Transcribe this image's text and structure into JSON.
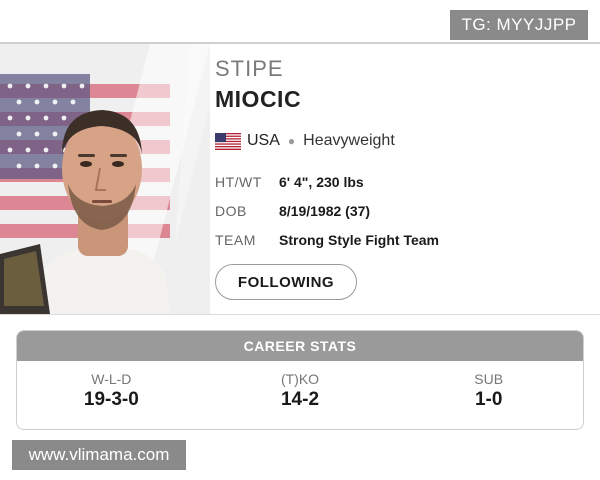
{
  "watermark_top": "TG: MYYJJPP",
  "watermark_bottom": "www.vlimama.com",
  "fighter": {
    "first_name": "STIPE",
    "last_name": "MIOCIC",
    "country": "USA",
    "division": "Heavyweight",
    "flag_icon": "us-flag-icon",
    "stats": [
      {
        "label": "HT/WT",
        "value": "6' 4\", 230 lbs"
      },
      {
        "label": "DOB",
        "value": "8/19/1982 (37)"
      },
      {
        "label": "TEAM",
        "value": "Strong Style Fight Team"
      }
    ]
  },
  "follow_button": "FOLLOWING",
  "career_stats": {
    "title": "CAREER STATS",
    "items": [
      {
        "label": "W-L-D",
        "value": "19-3-0"
      },
      {
        "label": "(T)KO",
        "value": "14-2"
      },
      {
        "label": "SUB",
        "value": "1-0"
      }
    ]
  },
  "colors": {
    "header_grey": "#9a9a9a",
    "flag_red": "#b22234",
    "flag_blue": "#3c3b6e"
  }
}
